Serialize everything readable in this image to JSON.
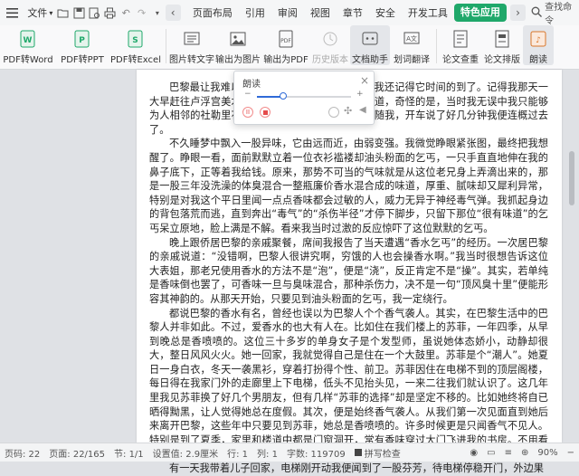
{
  "menubar": {
    "file_label": "文件",
    "tabs": [
      "页面布局",
      "引用",
      "审阅",
      "视图",
      "章节",
      "安全",
      "开发工具",
      "特色应用"
    ],
    "search_placeholder": "查找命令"
  },
  "ribbon": {
    "buttons": [
      "PDF转Word",
      "PDF转PPT",
      "PDF转Excel",
      "图片转文字",
      "输出为图片",
      "输出为PDF",
      "历史版本",
      "文档助手",
      "划词翻译",
      "论文查重",
      "论文排版",
      "朗读"
    ]
  },
  "reader": {
    "title": "朗读",
    "progress": 0.28
  },
  "document": {
    "paragraphs": [
      "巴黎最让我难以忘怀的是那一种气味，到现在我还记得它时间的到了。记得我那天一大早赶往卢浮宫美术馆，却在地铁里闻到了那股味道，奇怪的是，当时我无误中我只能够为人相邻的社勒里花园小憩。哪知这股香味一直伴随我，开车说了好几分钟我便连概过去了。",
      "不久睡梦中飘入一股异味，它由远而近，由弱变强。我微觉睁眼紧张图，最终把我想醒了。睁眼一看，面前默默立着一位衣衫褴褛却油头粉面的乞丐，一只手直直地伸在我的鼻子底下，正等着我给钱。原来，那势不可当的气味就是从这位老兄身上弄滴出来的，那是一股三年没洗澡的体臭混合一整瓶廉价香水混合成的味道，厚重、腻味却又犀利异常，特别是对我这个平日里闻一点点香味都会过敏的人，威力无异于神经毒气弹。我抓起身边的背包落荒而逃，直到奔出“毒气”的“杀伤半径”才停下脚步，只留下那位“很有味道”的乞丐呆立原地，脸上满是不解。看来我当时过激的反应惊吓了这位默默的乞丐。",
      "晚上跟侨居巴黎的亲戚聚餐，席间我报告了当天遭遇“香水乞丐”的经历。一次居巴黎的亲戚说道：“没错啊，巴黎人很讲究啊，穷饿的人也会操香水啊。”我当时很想告诉这位大表姐，那老兄使用香水的方法不是“泡”，便是“浇”，反正肯定不是“操”。其实，若单纯是香味倒也罢了，可香味一旦与臭味混合，那种杀伤力，决不是一句“顶风臭十里”便能形容其神韵的。从那天开始，只要见到油头粉面的乞丐，我一定绕行。",
      "都说巴黎的香水有名，曾经也误以为巴黎人个个香气袭人。其实，在巴黎生活中的巴黎人并非如此。不过，爱香水的也大有人在。比如住在我们楼上的苏菲，一年四季，从早到晚总是香喷喷的。这位三十多岁的单身女子是个发型师，虽说她体态娇小，动静却很大，整日风风火火。她一回家，我就觉得自己是住在一个大鼓里。苏菲是个“潮人”。她夏日一身白衣，冬天一袭黑衫，穿着打扮得个性、前卫。苏菲因住在电梯不到的顶层阁楼，每日得在我家门外的走廊里上下电梯，低头不见抬头见，一来二往我们就认识了。这几年里我见苏菲换了好几个男朋友，但有几样“苏菲的选择”却是坚定不移的。比如她终将自已晒得黝黑，让人觉得她总在度假。其次，便是始终香气袭人。从我们第一次见面直到她后来离开巴黎，这些年中只要见到苏菲，她总是香喷喷的。许多时候更是只闻香气不见人。特别是到了夏季，家里和楼道中都是门窗洞开，常有香味穿过大门飞进我的书房。不用看便知道，肯定是打扮得漂漂亮亮的苏菲正在走廊里等电梯呢。",
      "有一天我带着儿子回家，电梯刚开动我便闻到了一股芬芳，待电梯停稳开门，外边果"
    ]
  },
  "status": {
    "page_code": "页码: 22",
    "page": "页面: 22/165",
    "section": "节: 1/1",
    "setting": "设置值: 2.9厘米",
    "row": "行: 1",
    "col": "列: 1",
    "words": "字数: 119709",
    "spellcheck": "拼写检查",
    "zoom": "90%"
  },
  "colors": {
    "accent": "#1fa86a"
  }
}
